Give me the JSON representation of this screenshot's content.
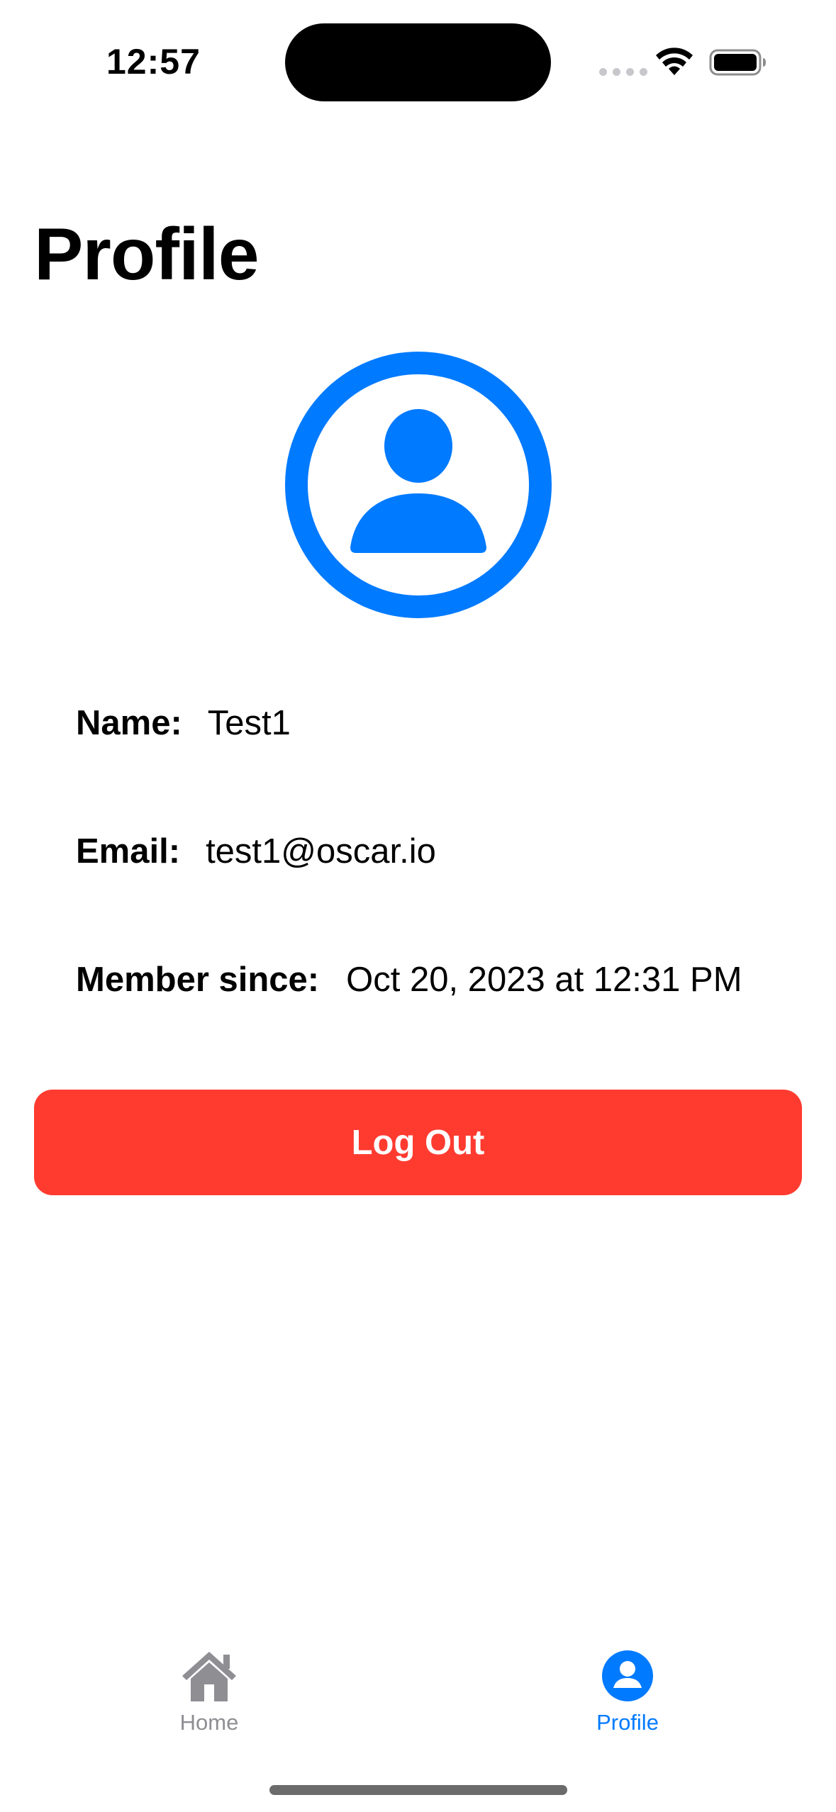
{
  "status_bar": {
    "time": "12:57"
  },
  "page": {
    "title": "Profile"
  },
  "profile": {
    "avatar_icon": "person-crop-circle-icon",
    "fields": [
      {
        "label": "Name:",
        "value": "Test1"
      },
      {
        "label": "Email:",
        "value": "test1@oscar.io"
      },
      {
        "label": "Member since:",
        "value": "Oct 20, 2023 at 12:31 PM"
      }
    ],
    "logout_label": "Log Out"
  },
  "tab_bar": {
    "tabs": [
      {
        "label": "Home",
        "icon": "house-icon",
        "selected": false
      },
      {
        "label": "Profile",
        "icon": "person-circle-icon",
        "selected": true
      }
    ]
  },
  "colors": {
    "accent": "#007aff",
    "destructive": "#ff3b30",
    "inactive_tab": "#8e8e93"
  }
}
